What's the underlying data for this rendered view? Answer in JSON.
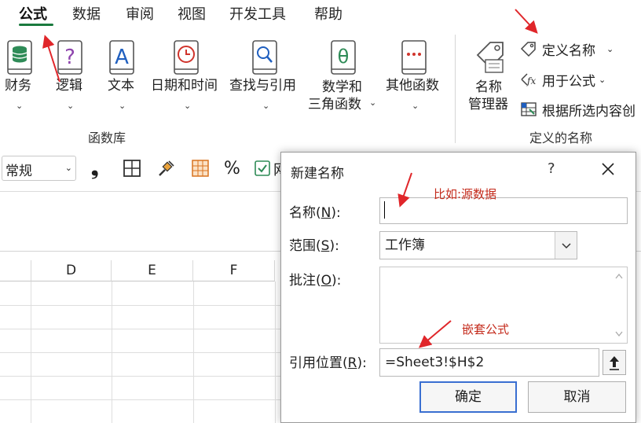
{
  "ribbon_tabs": [
    "公式",
    "数据",
    "审阅",
    "视图",
    "开发工具",
    "帮助"
  ],
  "function_library": {
    "group_label": "函数库",
    "items": [
      {
        "label": "财务",
        "icon": "database-book-icon"
      },
      {
        "label": "逻辑",
        "icon": "question-book-icon"
      },
      {
        "label": "文本",
        "icon": "text-book-icon"
      },
      {
        "label": "日期和时间",
        "icon": "clock-book-icon"
      },
      {
        "label": "查找与引用",
        "icon": "magnifier-book-icon"
      },
      {
        "label_line1": "数学和",
        "label_line2": "三角函数",
        "icon": "theta-book-icon"
      },
      {
        "label": "其他函数",
        "icon": "dots-book-icon"
      }
    ]
  },
  "defined_names": {
    "group_label": "定义的名称",
    "name_manager": {
      "line1": "名称",
      "line2": "管理器",
      "icon": "tag-icon"
    },
    "define_name": "定义名称",
    "use_in_formula": "用于公式",
    "create_from_selection": "根据所选内容创"
  },
  "format_bar": {
    "number_format": "常规",
    "comma_symbol": "❟",
    "percent_symbol": "%",
    "truncated_text": "网"
  },
  "grid": {
    "columns": [
      "D",
      "E",
      "F"
    ]
  },
  "dialog": {
    "title": "新建名称",
    "help": "?",
    "name_label": "名称(",
    "name_key": "N",
    "name_label_end": "):",
    "name_value": "",
    "scope_label": "范围(",
    "scope_key": "S",
    "scope_label_end": "):",
    "scope_value": "工作簿",
    "comment_label": "批注(",
    "comment_key": "O",
    "comment_label_end": "):",
    "ref_label": "引用位置(",
    "ref_key": "R",
    "ref_label_end": "):",
    "ref_value": "=Sheet3!$H$2",
    "ok": "确定",
    "cancel": "取消"
  },
  "annotations": {
    "source_data_note": "比如:源数据",
    "nested_formula_note": "嵌套公式"
  },
  "colors": {
    "accent_green": "#1a7a3e",
    "annotation_red": "#d0021b",
    "ok_border": "#3a6fd1"
  }
}
